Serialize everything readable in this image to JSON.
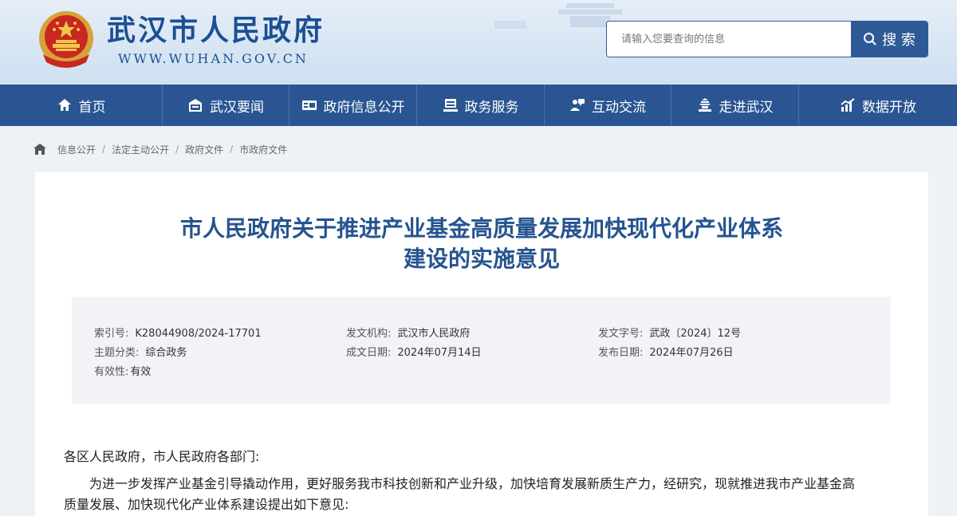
{
  "site": {
    "title": "武汉市人民政府",
    "url": "WWW.WUHAN.GOV.CN"
  },
  "search": {
    "placeholder": "请输入您要查询的信息",
    "button_label": "搜 索"
  },
  "nav": [
    {
      "label": "首页",
      "icon": "home-icon"
    },
    {
      "label": "武汉要闻",
      "icon": "news-icon"
    },
    {
      "label": "政府信息公开",
      "icon": "info-icon"
    },
    {
      "label": "政务服务",
      "icon": "service-icon"
    },
    {
      "label": "互动交流",
      "icon": "chat-icon"
    },
    {
      "label": "走进武汉",
      "icon": "city-icon"
    },
    {
      "label": "数据开放",
      "icon": "data-icon"
    }
  ],
  "breadcrumb": [
    "信息公开",
    "法定主动公开",
    "政府文件",
    "市政府文件"
  ],
  "document": {
    "title_line1": "市人民政府关于推进产业基金高质量发展加快现代化产业体系",
    "title_line2": "建设的实施意见",
    "meta": {
      "index_no_label": "索引号:",
      "index_no": "K28044908/2024-17701",
      "issuer_label": "发文机构:",
      "issuer": "武汉市人民政府",
      "doc_no_label": "发文字号:",
      "doc_no": "武政〔2024〕12号",
      "category_label": "主题分类:",
      "category": "综合政务",
      "created_label": "成文日期:",
      "created": "2024年07月14日",
      "published_label": "发布日期:",
      "published": "2024年07月26日",
      "validity_label": "有效性:",
      "validity": "有效"
    },
    "salutation": "各区人民政府，市人民政府各部门:",
    "para1_line1": "为进一步发挥产业基金引导撬动作用，更好服务我市科技创新和产业升级，加快培育发展新质生产力，经研究，现就推进我市产业基金高",
    "para1_line2": "质量发展、加快现代化产业体系建设提出如下意见:"
  },
  "colors": {
    "brand_blue": "#2a5592",
    "title_blue": "#25548f"
  }
}
